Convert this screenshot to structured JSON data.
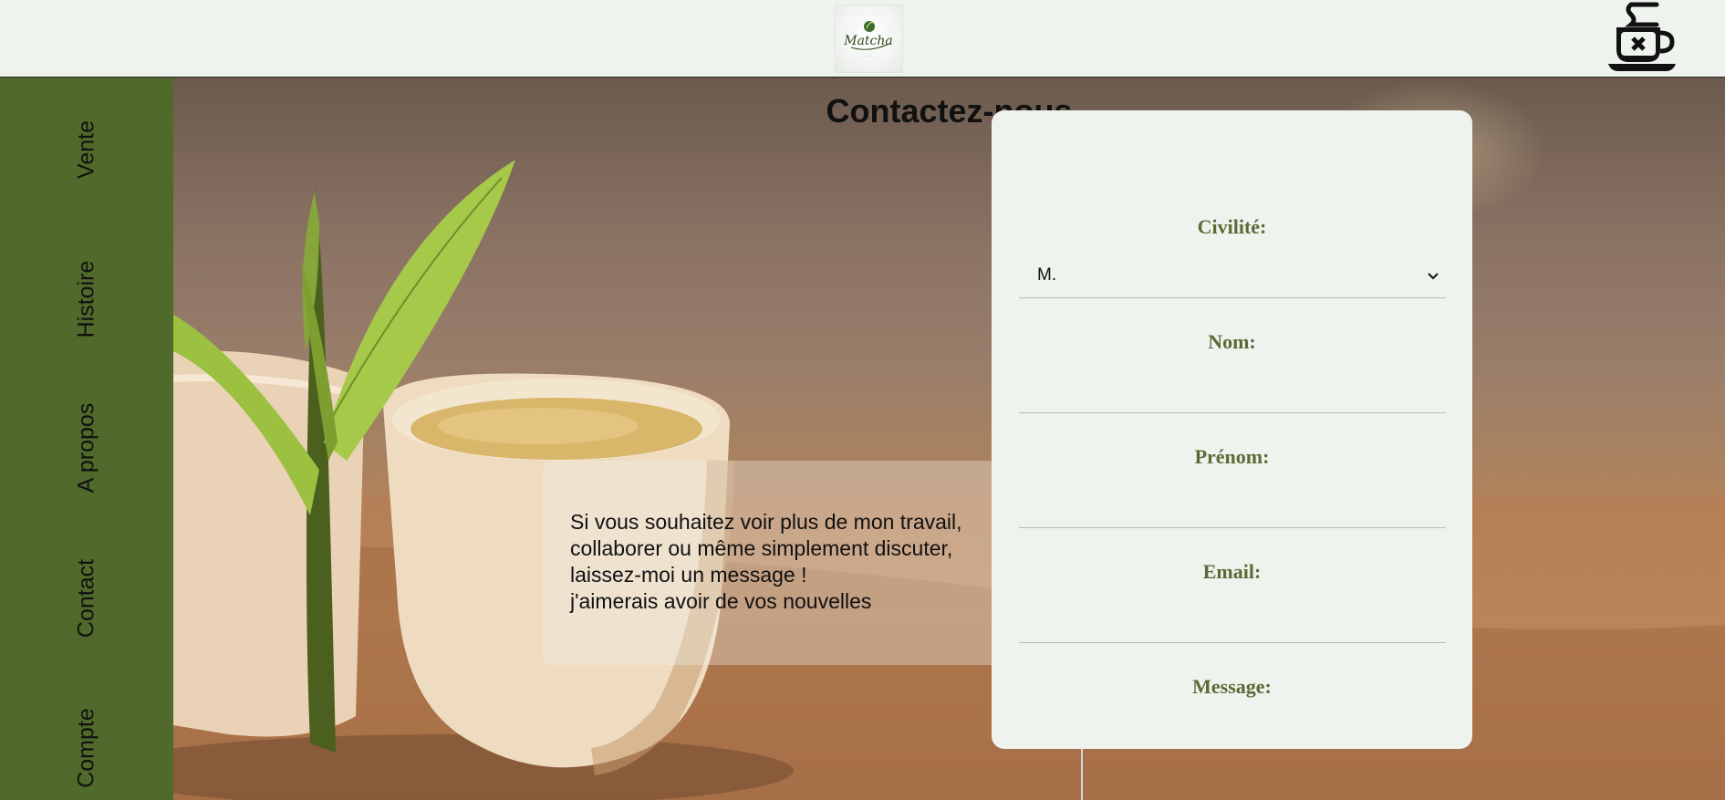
{
  "header": {
    "logo_alt": "Matcha",
    "cart_icon": "coffee-cup-icon"
  },
  "sidebar": {
    "items": [
      {
        "label": "Vente"
      },
      {
        "label": "Histoire"
      },
      {
        "label": "A propos"
      },
      {
        "label": "Contact"
      },
      {
        "label": "Compte"
      }
    ]
  },
  "main": {
    "title": "Contactez-nous",
    "message_lines": [
      "Si vous souhaitez voir plus de mon travail,",
      "collaborer ou même simplement discuter,",
      "laissez-moi un message !",
      "j'aimerais avoir de vos nouvelles"
    ]
  },
  "form": {
    "civility_label": "Civilité:",
    "civility_value": "M.",
    "name_label": "Nom:",
    "firstname_label": "Prénom:",
    "email_label": "Email:",
    "message_label": "Message:"
  },
  "colors": {
    "sidebar": "#4f6a2a",
    "label": "#5a6b35",
    "background": "#eef3ee"
  }
}
